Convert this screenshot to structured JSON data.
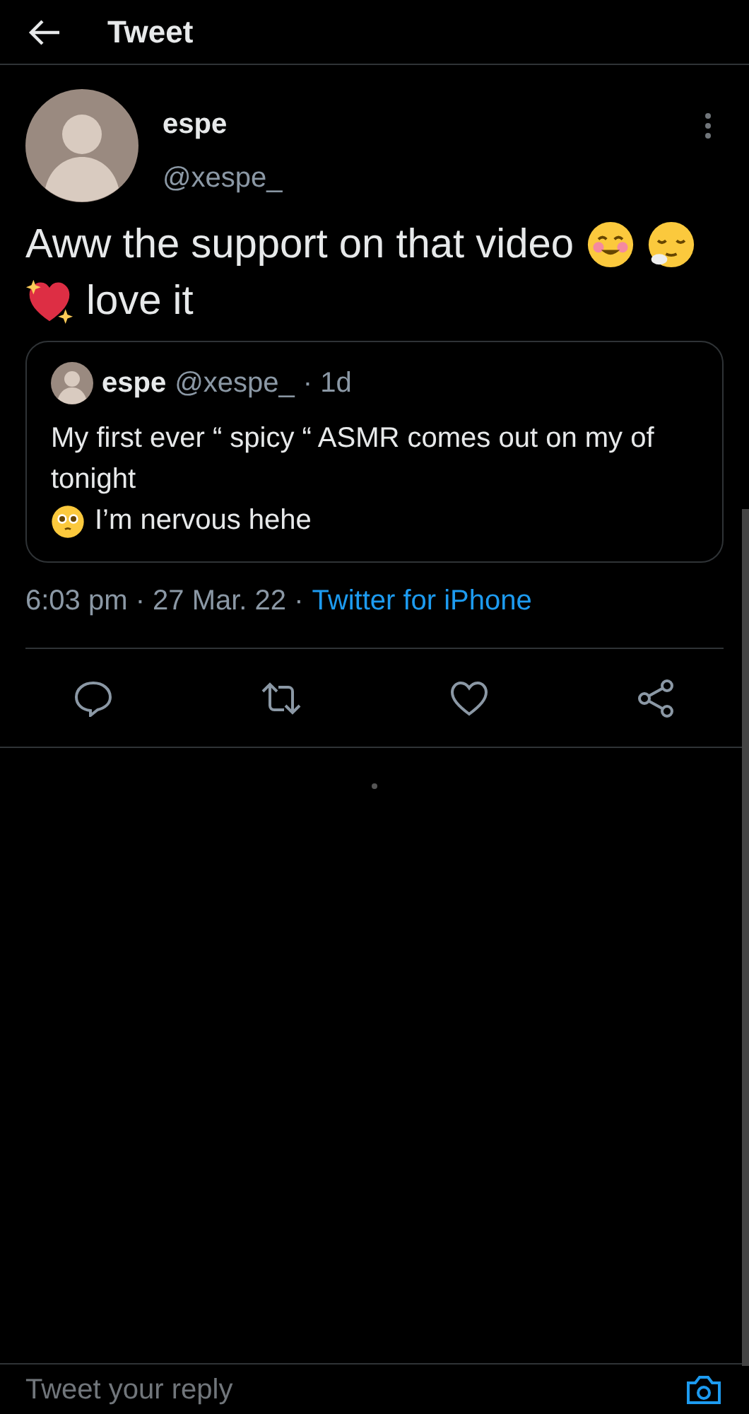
{
  "header": {
    "title": "Tweet"
  },
  "tweet": {
    "name": "espe",
    "handle": "@xespe_",
    "body": [
      {
        "kind": "text",
        "text": "Aww the support on that video"
      },
      {
        "kind": "smiling-face"
      },
      {
        "kind": "relieved-face"
      },
      {
        "kind": "sparkling-heart"
      },
      {
        "kind": "text",
        "text": "love it"
      }
    ]
  },
  "quote": {
    "name": "espe",
    "handle": "@xespe_",
    "time": "· 1d",
    "body": [
      {
        "kind": "text",
        "text": "My first ever “ spicy “ ASMR comes out on my of tonight"
      },
      {
        "kind": "pleading-face"
      },
      {
        "kind": "text",
        "text": "I’m nervous hehe"
      }
    ]
  },
  "meta": {
    "time": "6:03 pm · 27 Mar. 22 ·",
    "source": "Twitter for iPhone"
  },
  "reply": {
    "placeholder": "Tweet your reply"
  }
}
